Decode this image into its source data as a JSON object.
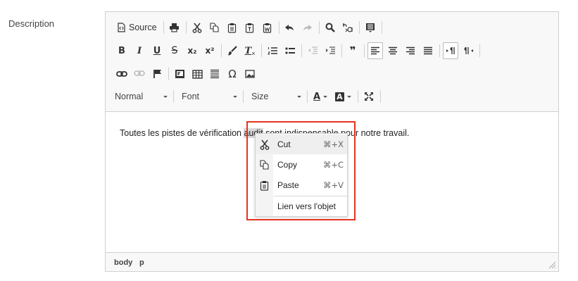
{
  "field": {
    "label": "Description"
  },
  "toolbar": {
    "source_label": "Source",
    "format_value": "Normal",
    "font_value": "Font",
    "size_value": "Size",
    "bold_glyph": "B",
    "italic_glyph": "I",
    "underline_glyph": "U",
    "strike_glyph": "S",
    "subscript_glyph": "x₂",
    "superscript_glyph": "x²",
    "removeformat_glyph": "T",
    "blockquote_glyph": "❞",
    "omega_glyph": "Ω",
    "textcolor_glyph": "A",
    "bgcolor_glyph": "A"
  },
  "content": {
    "text_before": "Toutes les pistes de vérification ",
    "selected_word": "audit",
    "text_after": " sont indispensable pour notre travail."
  },
  "footer": {
    "path": [
      "body",
      "p"
    ]
  },
  "context_menu": {
    "items": [
      {
        "label": "Cut",
        "shortcut": "⌘+X",
        "icon": "scissors-icon"
      },
      {
        "label": "Copy",
        "shortcut": "⌘+C",
        "icon": "copy-icon"
      },
      {
        "label": "Paste",
        "shortcut": "⌘+V",
        "icon": "paste-icon"
      },
      {
        "label": "Lien vers l'objet",
        "shortcut": "",
        "icon": ""
      }
    ]
  },
  "colors": {
    "highlight_border": "#e53320",
    "toolbar_bg": "#f8f8f8",
    "border": "#d1d1d1"
  }
}
